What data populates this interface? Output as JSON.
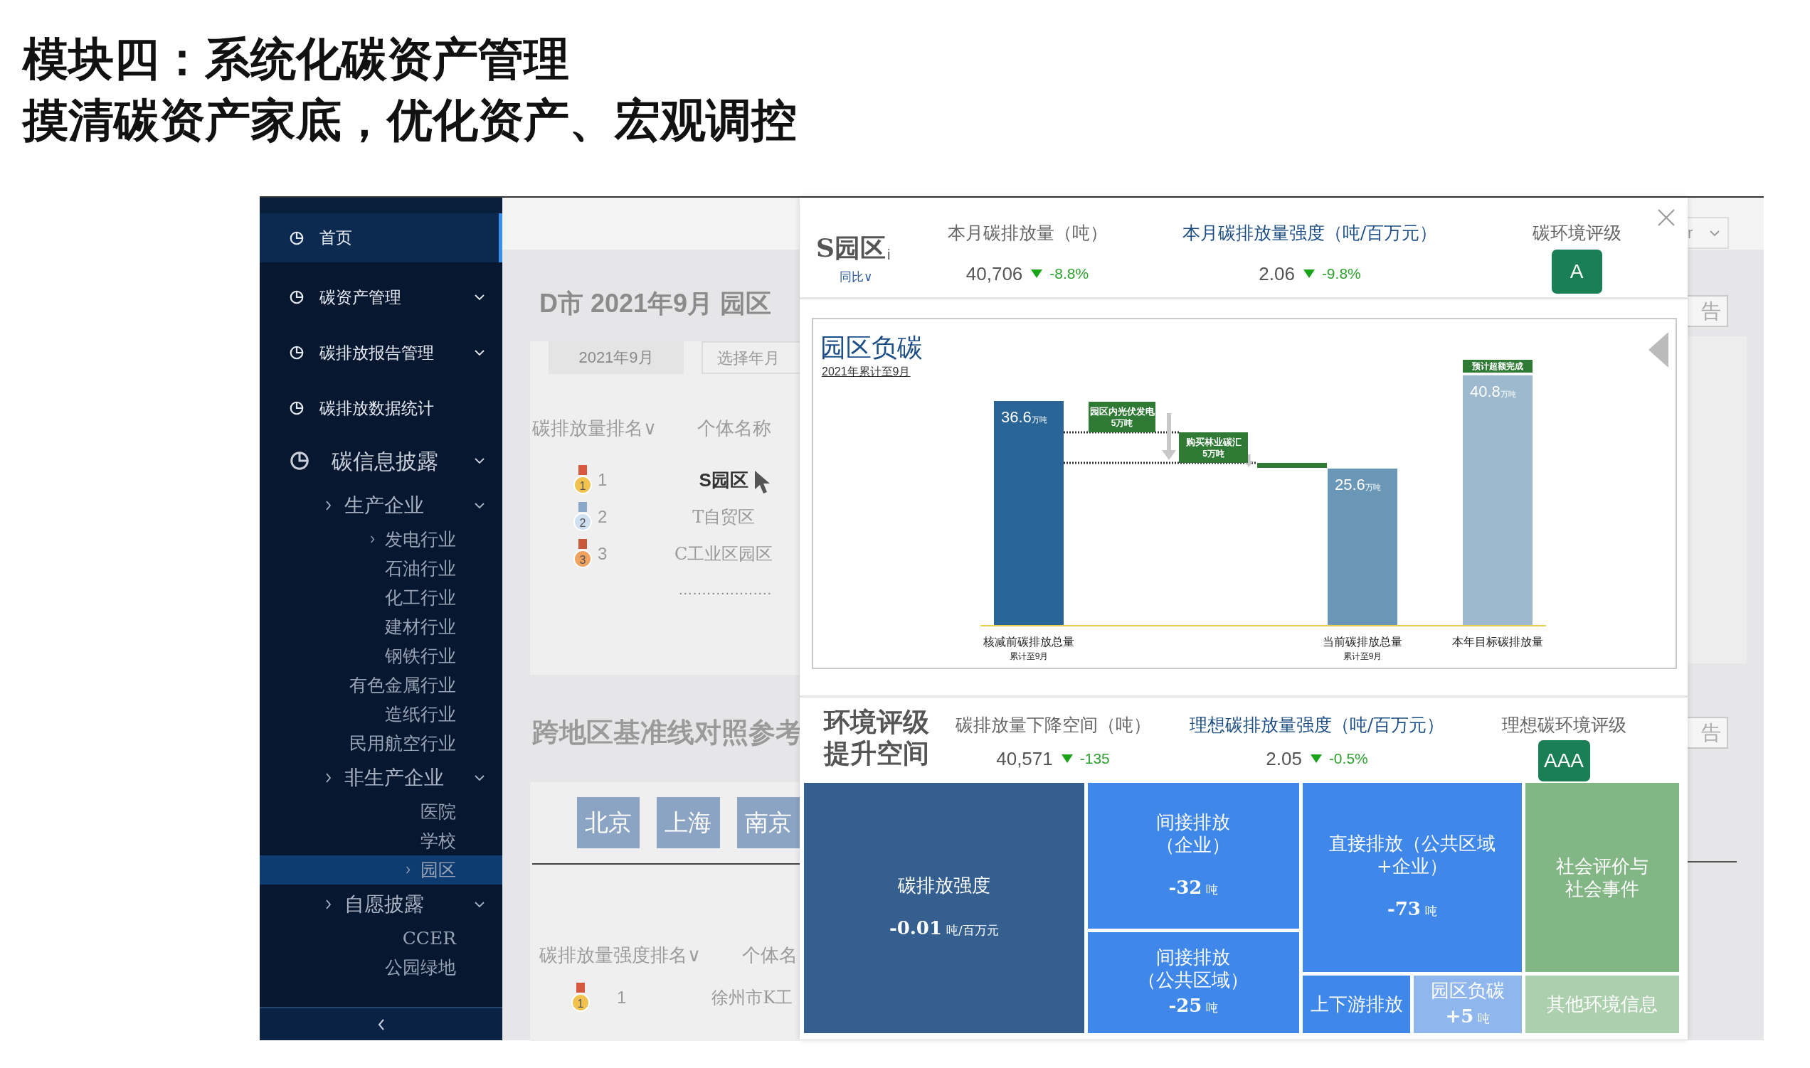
{
  "slide": {
    "title": "模块四：系统化碳资产管理",
    "subtitle": "摸清碳资产家底，优化资产、宏观调控"
  },
  "sidebar": {
    "items": [
      {
        "label": "首页",
        "icon": true,
        "selected": true
      },
      {
        "label": "碳资产管理",
        "icon": true,
        "dropdown": true,
        "selected": false
      },
      {
        "label": "碳排放报告管理",
        "icon": true,
        "dropdown": true,
        "selected": false
      },
      {
        "label": "碳排放数据统计",
        "icon": true,
        "selected": false
      },
      {
        "label": "碳信息披露",
        "icon": true,
        "dropdown": true,
        "selected": false,
        "children": [
          {
            "label": "生产企业",
            "arrow": true,
            "dropdown": true,
            "selected": false,
            "children": [
              {
                "label": "发电行业",
                "arrow": true,
                "selected": false
              },
              {
                "label": "石油行业",
                "selected": false
              },
              {
                "label": "化工行业",
                "selected": false
              },
              {
                "label": "建材行业",
                "selected": false
              },
              {
                "label": "钢铁行业",
                "selected": false
              },
              {
                "label": "有色金属行业",
                "selected": false
              },
              {
                "label": "造纸行业",
                "selected": false
              },
              {
                "label": "民用航空行业",
                "selected": false
              }
            ]
          },
          {
            "label": "非生产企业",
            "arrow": true,
            "dropdown": true,
            "selected": false,
            "children": [
              {
                "label": "医院",
                "selected": false
              },
              {
                "label": "学校",
                "selected": false
              },
              {
                "label": "园区",
                "arrow": true,
                "selected": true
              }
            ]
          },
          {
            "label": "自愿披露",
            "arrow": true,
            "dropdown": true,
            "selected": false,
            "children": [
              {
                "label": "CCER",
                "selected": false
              },
              {
                "label": "公园绿地",
                "selected": false
              }
            ]
          }
        ]
      }
    ]
  },
  "page": {
    "heading": "D市 2021年9月 园区",
    "date_field": {
      "value": "2021年9月"
    },
    "month_field": {
      "placeholder": "选择年月"
    },
    "ranking": {
      "columns": [
        "碳排放量排名∨",
        "个体名称"
      ],
      "rows": [
        {
          "medal": "1",
          "rank": "1",
          "name": "S园区",
          "selected": true
        },
        {
          "medal": "2",
          "rank": "2",
          "name": "T自贸区",
          "selected": false
        },
        {
          "medal": "3",
          "rank": "3",
          "name": "C工业区园区",
          "selected": false
        }
      ],
      "more": "...................."
    },
    "section2": {
      "heading": "跨地区基准线对照参考",
      "cities": [
        "北京",
        "上海",
        "南京"
      ],
      "ranking": {
        "columns": [
          "碳排放量强度排名∨",
          "个体名"
        ],
        "rows": [
          {
            "medal": "1",
            "rank": "1",
            "name": "徐州市K工"
          }
        ]
      }
    }
  },
  "right_strip": {
    "dropdown": "r",
    "buttons": [
      "告",
      "告"
    ]
  },
  "popup": {
    "title": "S园区",
    "info": "i",
    "compare": "同比∨",
    "metrics": [
      {
        "label": "本月碳排放量（吨）",
        "value": "40,706",
        "falling": true,
        "delta": "-8.8%",
        "highlighted": false
      },
      {
        "label": "本月碳排放量强度（吨/百万元）",
        "value": "2.06",
        "falling": true,
        "delta": "-9.8%",
        "highlighted": true
      }
    ],
    "grade": {
      "label": "碳环境评级",
      "value": "A"
    },
    "chart_panel": {
      "title": "园区负碳",
      "subtitle": "2021年累计至9月",
      "chart_data": {
        "type": "bar",
        "categories": [
          "核减前碳排放总量",
          "当前碳排放总量",
          "本年目标碳排放量"
        ],
        "values": [
          36.6,
          25.6,
          40.8
        ],
        "value_labels": [
          "36.6$_{万吨}$",
          "25.6$_{万吨}$",
          "40.8$_{万吨}$"
        ]
      },
      "category_notes": [
        "累计至9月",
        "累计至9月"
      ],
      "reductions": [
        {
          "label": "园区内光伏发电",
          "amount": "5万吨"
        },
        {
          "label": "购买林业碳汇",
          "amount": "5万吨"
        }
      ],
      "target_badge": "预计超额完成"
    },
    "improvement": {
      "title": "环境评级提升空间",
      "metrics": [
        {
          "label": "碳排放量下降空间（吨）",
          "value": "40,571",
          "falling": true,
          "delta": "-135",
          "highlighted": false
        },
        {
          "label": "理想碳排放量强度（吨/百万元）",
          "value": "2.05",
          "falling": true,
          "delta": "-0.5%",
          "highlighted": true
        }
      ],
      "grade": {
        "label": "理想碳环境评级",
        "value": "AAA"
      },
      "treemap": [
        {
          "label": "碳排放强度",
          "value": "-0.01",
          "unit": "吨/百万元",
          "color": "#355f8f"
        },
        {
          "label": "间接排放（企业）",
          "value": "-32",
          "unit": "吨",
          "color": "#3f88ea"
        },
        {
          "label": "间接排放（公共区域）",
          "value": "-25",
          "unit": "吨",
          "color": "#3f88ea"
        },
        {
          "label": "直接排放（公共区域+企业）",
          "value": "-73",
          "unit": "吨",
          "color": "#3f88ea"
        },
        {
          "label": "上下游排放",
          "color": "#3f88ea"
        },
        {
          "label": "园区负碳",
          "value": "+5",
          "unit": "吨",
          "color": "#8fb7ee"
        },
        {
          "label": "社会评价与社会事件",
          "color": "#82b785"
        },
        {
          "label": "其他环境信息",
          "color": "#acd0ad"
        }
      ]
    }
  }
}
